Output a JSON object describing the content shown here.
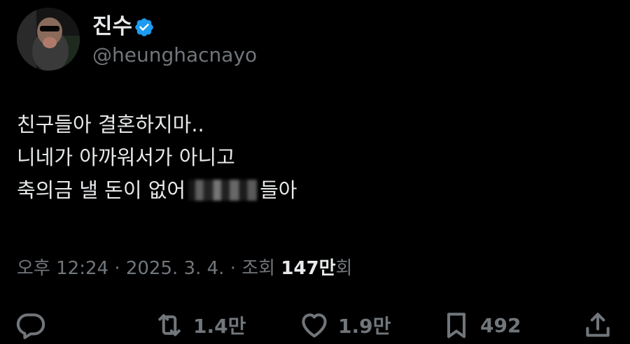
{
  "author": {
    "display_name": "진수",
    "handle": "@heunghacnayo",
    "verified_badge_color": "#1d9bf0"
  },
  "tweet": {
    "lines": [
      "친구들아 결혼하지마..",
      "니네가 아까워서가 아니고"
    ],
    "line3_before": "축의금 낼 돈이 없어",
    "line3_after": "들아"
  },
  "meta": {
    "time": "오후 12:24",
    "date": "2025. 3. 4.",
    "separator": "·",
    "views_label": "조회",
    "views_count": "147만",
    "views_suffix": "회"
  },
  "actions": {
    "reply_icon": "reply-icon",
    "retweet_count": "1.4만",
    "like_count": "1.9만",
    "bookmark_count": "492",
    "share_icon": "share-icon"
  },
  "colors": {
    "background": "#000000",
    "primary_text": "#e7e9ea",
    "secondary_text": "#71767b"
  }
}
